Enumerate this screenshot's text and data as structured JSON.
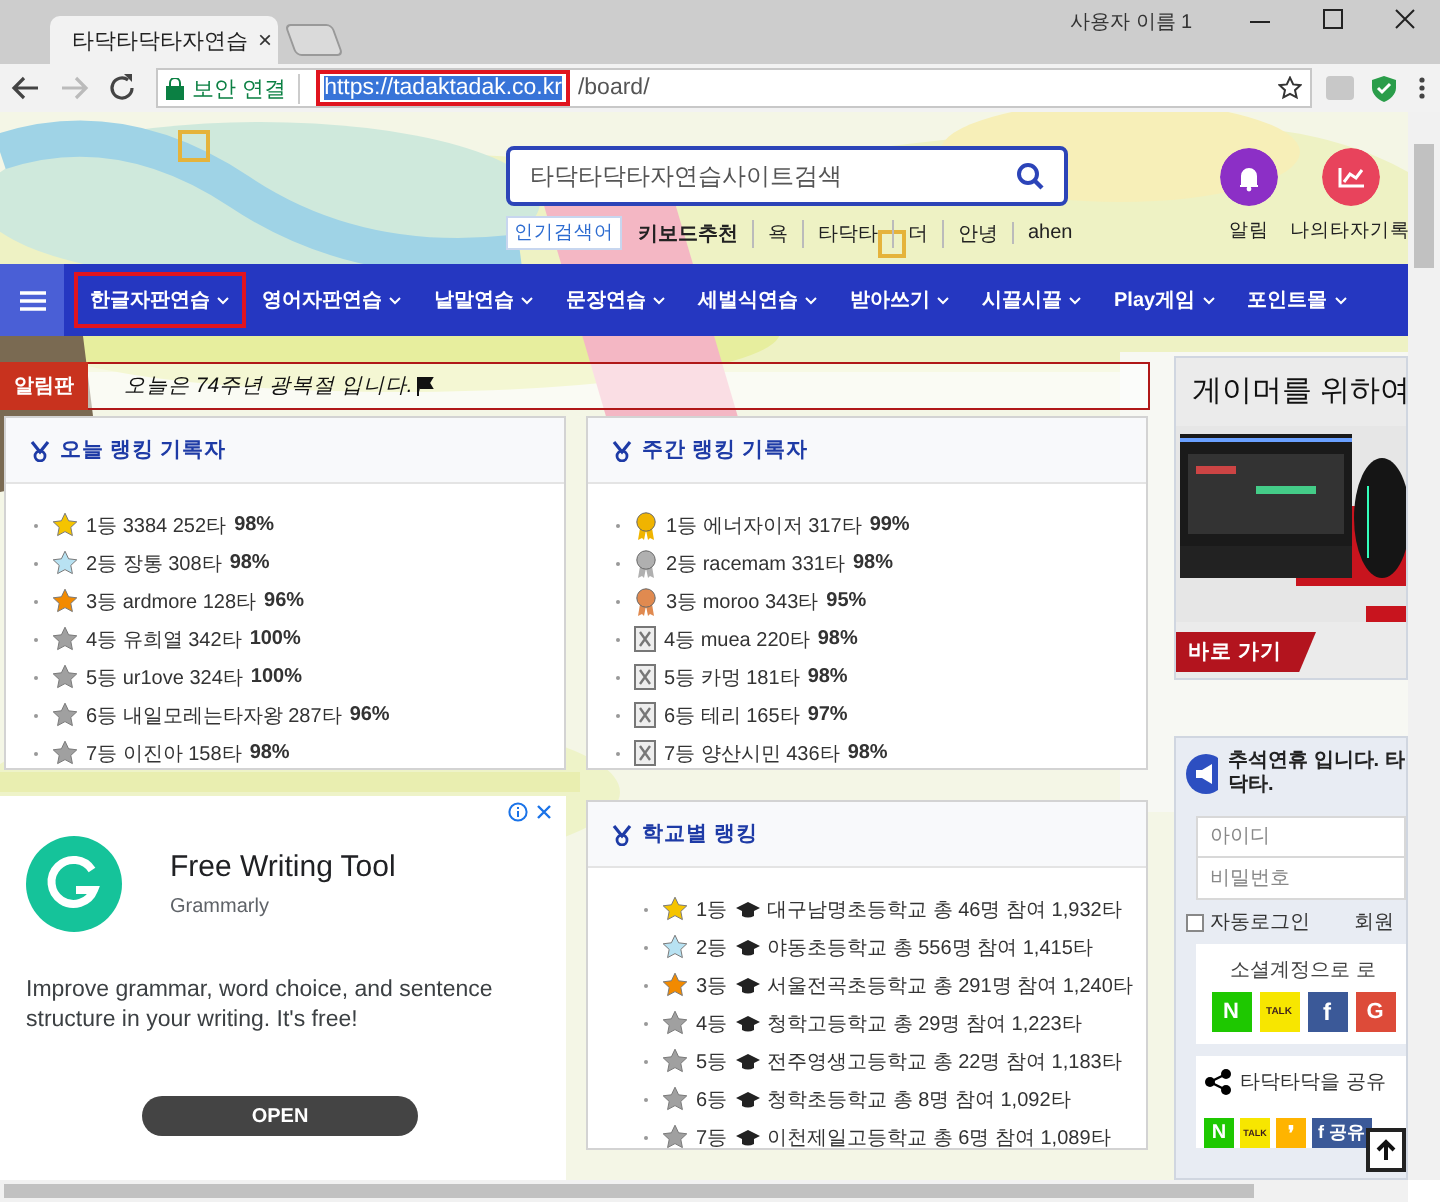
{
  "browser": {
    "profile": "사용자 이름 1",
    "tab": {
      "title": "타닥타닥타자연습",
      "close": "×"
    },
    "security": "보안 연결",
    "url": {
      "selected": "https://tadaktadak.co.kr",
      "rest": "/board/",
      "annotated": true
    }
  },
  "header": {
    "search": {
      "placeholder": "타닥타닥타자연습사이트검색"
    },
    "popular_label": "인기검색어",
    "popular": [
      {
        "text": "키보드추천",
        "emphasized": true
      },
      {
        "text": "욕",
        "emphasized": false
      },
      {
        "text": "타닥타",
        "emphasized": false
      },
      {
        "text": "더",
        "emphasized": false
      },
      {
        "text": "안녕",
        "emphasized": false
      },
      {
        "text": "ahen",
        "emphasized": false
      }
    ],
    "shortcuts": [
      {
        "kind": "bell",
        "label": "알림",
        "color": "#8c2fc6"
      },
      {
        "kind": "chart",
        "label": "나의타자기록",
        "color": "#e8435c"
      }
    ]
  },
  "nav": {
    "items": [
      {
        "label": "한글자판연습",
        "annotated": true
      },
      {
        "label": "영어자판연습",
        "annotated": false
      },
      {
        "label": "낱말연습",
        "annotated": false
      },
      {
        "label": "문장연습",
        "annotated": false
      },
      {
        "label": "세벌식연습",
        "annotated": false
      },
      {
        "label": "받아쓰기",
        "annotated": false
      },
      {
        "label": "시끌시끌",
        "annotated": false
      },
      {
        "label": "Play게임",
        "annotated": false
      },
      {
        "label": "포인트몰",
        "annotated": false
      }
    ]
  },
  "notice": {
    "label": "알림판",
    "text": "오늘은 74주년 광복절 입니다."
  },
  "rankings": [
    {
      "kind": "players",
      "title": "오늘 랭킹 기록자",
      "entries": [
        {
          "text": "1등 3384 252타",
          "score": "98%",
          "kind": "star",
          "color": "#f5c400"
        },
        {
          "text": "2등 장통 308타",
          "score": "98%",
          "kind": "star",
          "color": "#b8e2f2"
        },
        {
          "text": "3등 ardmore 128타",
          "score": "96%",
          "kind": "star",
          "color": "#f28a00"
        },
        {
          "text": "4등 유희열 342타",
          "score": "100%",
          "kind": "star",
          "color": "#a0a0a0"
        },
        {
          "text": "5등 ur1ove 324타",
          "score": "100%",
          "kind": "star",
          "color": "#a0a0a0"
        },
        {
          "text": "6등 내일모레는타자왕 287타",
          "score": "96%",
          "kind": "star",
          "color": "#a0a0a0"
        },
        {
          "text": "7등 이진아 158타",
          "score": "98%",
          "kind": "star",
          "color": "#a0a0a0"
        }
      ]
    },
    {
      "kind": "players",
      "title": "주간 랭킹 기록자",
      "entries": [
        {
          "text": "1등 에너자이저 317타",
          "score": "99%",
          "kind": "medal",
          "color": "#f0b400"
        },
        {
          "text": "2등 racemam 331타",
          "score": "98%",
          "kind": "medal",
          "color": "#b0b0b0"
        },
        {
          "text": "3등 moroo 343타",
          "score": "95%",
          "kind": "medal",
          "color": "#e08a50"
        },
        {
          "text": "4등 muea 220타",
          "score": "98%",
          "kind": "frame",
          "color": "#777777"
        },
        {
          "text": "5등 카멍 181타",
          "score": "98%",
          "kind": "frame",
          "color": "#777777"
        },
        {
          "text": "6등 테리 165타",
          "score": "97%",
          "kind": "frame",
          "color": "#777777"
        },
        {
          "text": "7등 양산시민 436타",
          "score": "98%",
          "kind": "frame",
          "color": "#777777"
        }
      ]
    },
    {
      "kind": "schools",
      "title": "학교별 랭킹",
      "entries": [
        {
          "rank": "1등",
          "text": "대구남명초등학교 총 46명 참여 1,932타",
          "kind": "star",
          "color": "#f5c400"
        },
        {
          "rank": "2등",
          "text": "야동초등학교 총 556명 참여 1,415타",
          "kind": "star",
          "color": "#b8e2f2"
        },
        {
          "rank": "3등",
          "text": "서울전곡초등학교 총 291명 참여 1,240타",
          "kind": "star",
          "color": "#f28a00"
        },
        {
          "rank": "4등",
          "text": "청학고등학교 총 29명 참여 1,223타",
          "kind": "star",
          "color": "#a0a0a0"
        },
        {
          "rank": "5등",
          "text": "전주영생고등학교 총 22명 참여 1,183타",
          "kind": "star",
          "color": "#a0a0a0"
        },
        {
          "rank": "6등",
          "text": "청학초등학교 총 8명 참여 1,092타",
          "kind": "star",
          "color": "#a0a0a0"
        },
        {
          "rank": "7등",
          "text": "이천제일고등학교 총 6명 참여 1,089타",
          "kind": "star",
          "color": "#a0a0a0"
        }
      ]
    }
  ],
  "ad": {
    "title": "Free Writing Tool",
    "advertiser": "Grammarly",
    "body": "Improve grammar, word choice, and sentence structure in your writing. It's free!",
    "button": "OPEN"
  },
  "banner": {
    "headline": "게이머를 위하여",
    "button": "바로 가기"
  },
  "login": {
    "notice": "추석연휴 입니다. 타닥타.",
    "id_placeholder": "아이디",
    "pw_placeholder": "비밀번호",
    "auto_login": {
      "label": "자동로그인",
      "checked": false
    },
    "join": "회원",
    "social_title": "소셜계정으로 로",
    "social": [
      {
        "kind": "naver",
        "label": "N"
      },
      {
        "kind": "kakao",
        "label": "TALK"
      },
      {
        "kind": "facebook",
        "label": "f"
      },
      {
        "kind": "google",
        "label": "G"
      }
    ],
    "share_title": "타닥타닥을 공유",
    "share": [
      {
        "kind": "naver",
        "label": "N"
      },
      {
        "kind": "kakao",
        "label": "TALK"
      },
      {
        "kind": "story",
        "label": "❜"
      },
      {
        "kind": "facebook",
        "label": "f 공유"
      }
    ]
  }
}
